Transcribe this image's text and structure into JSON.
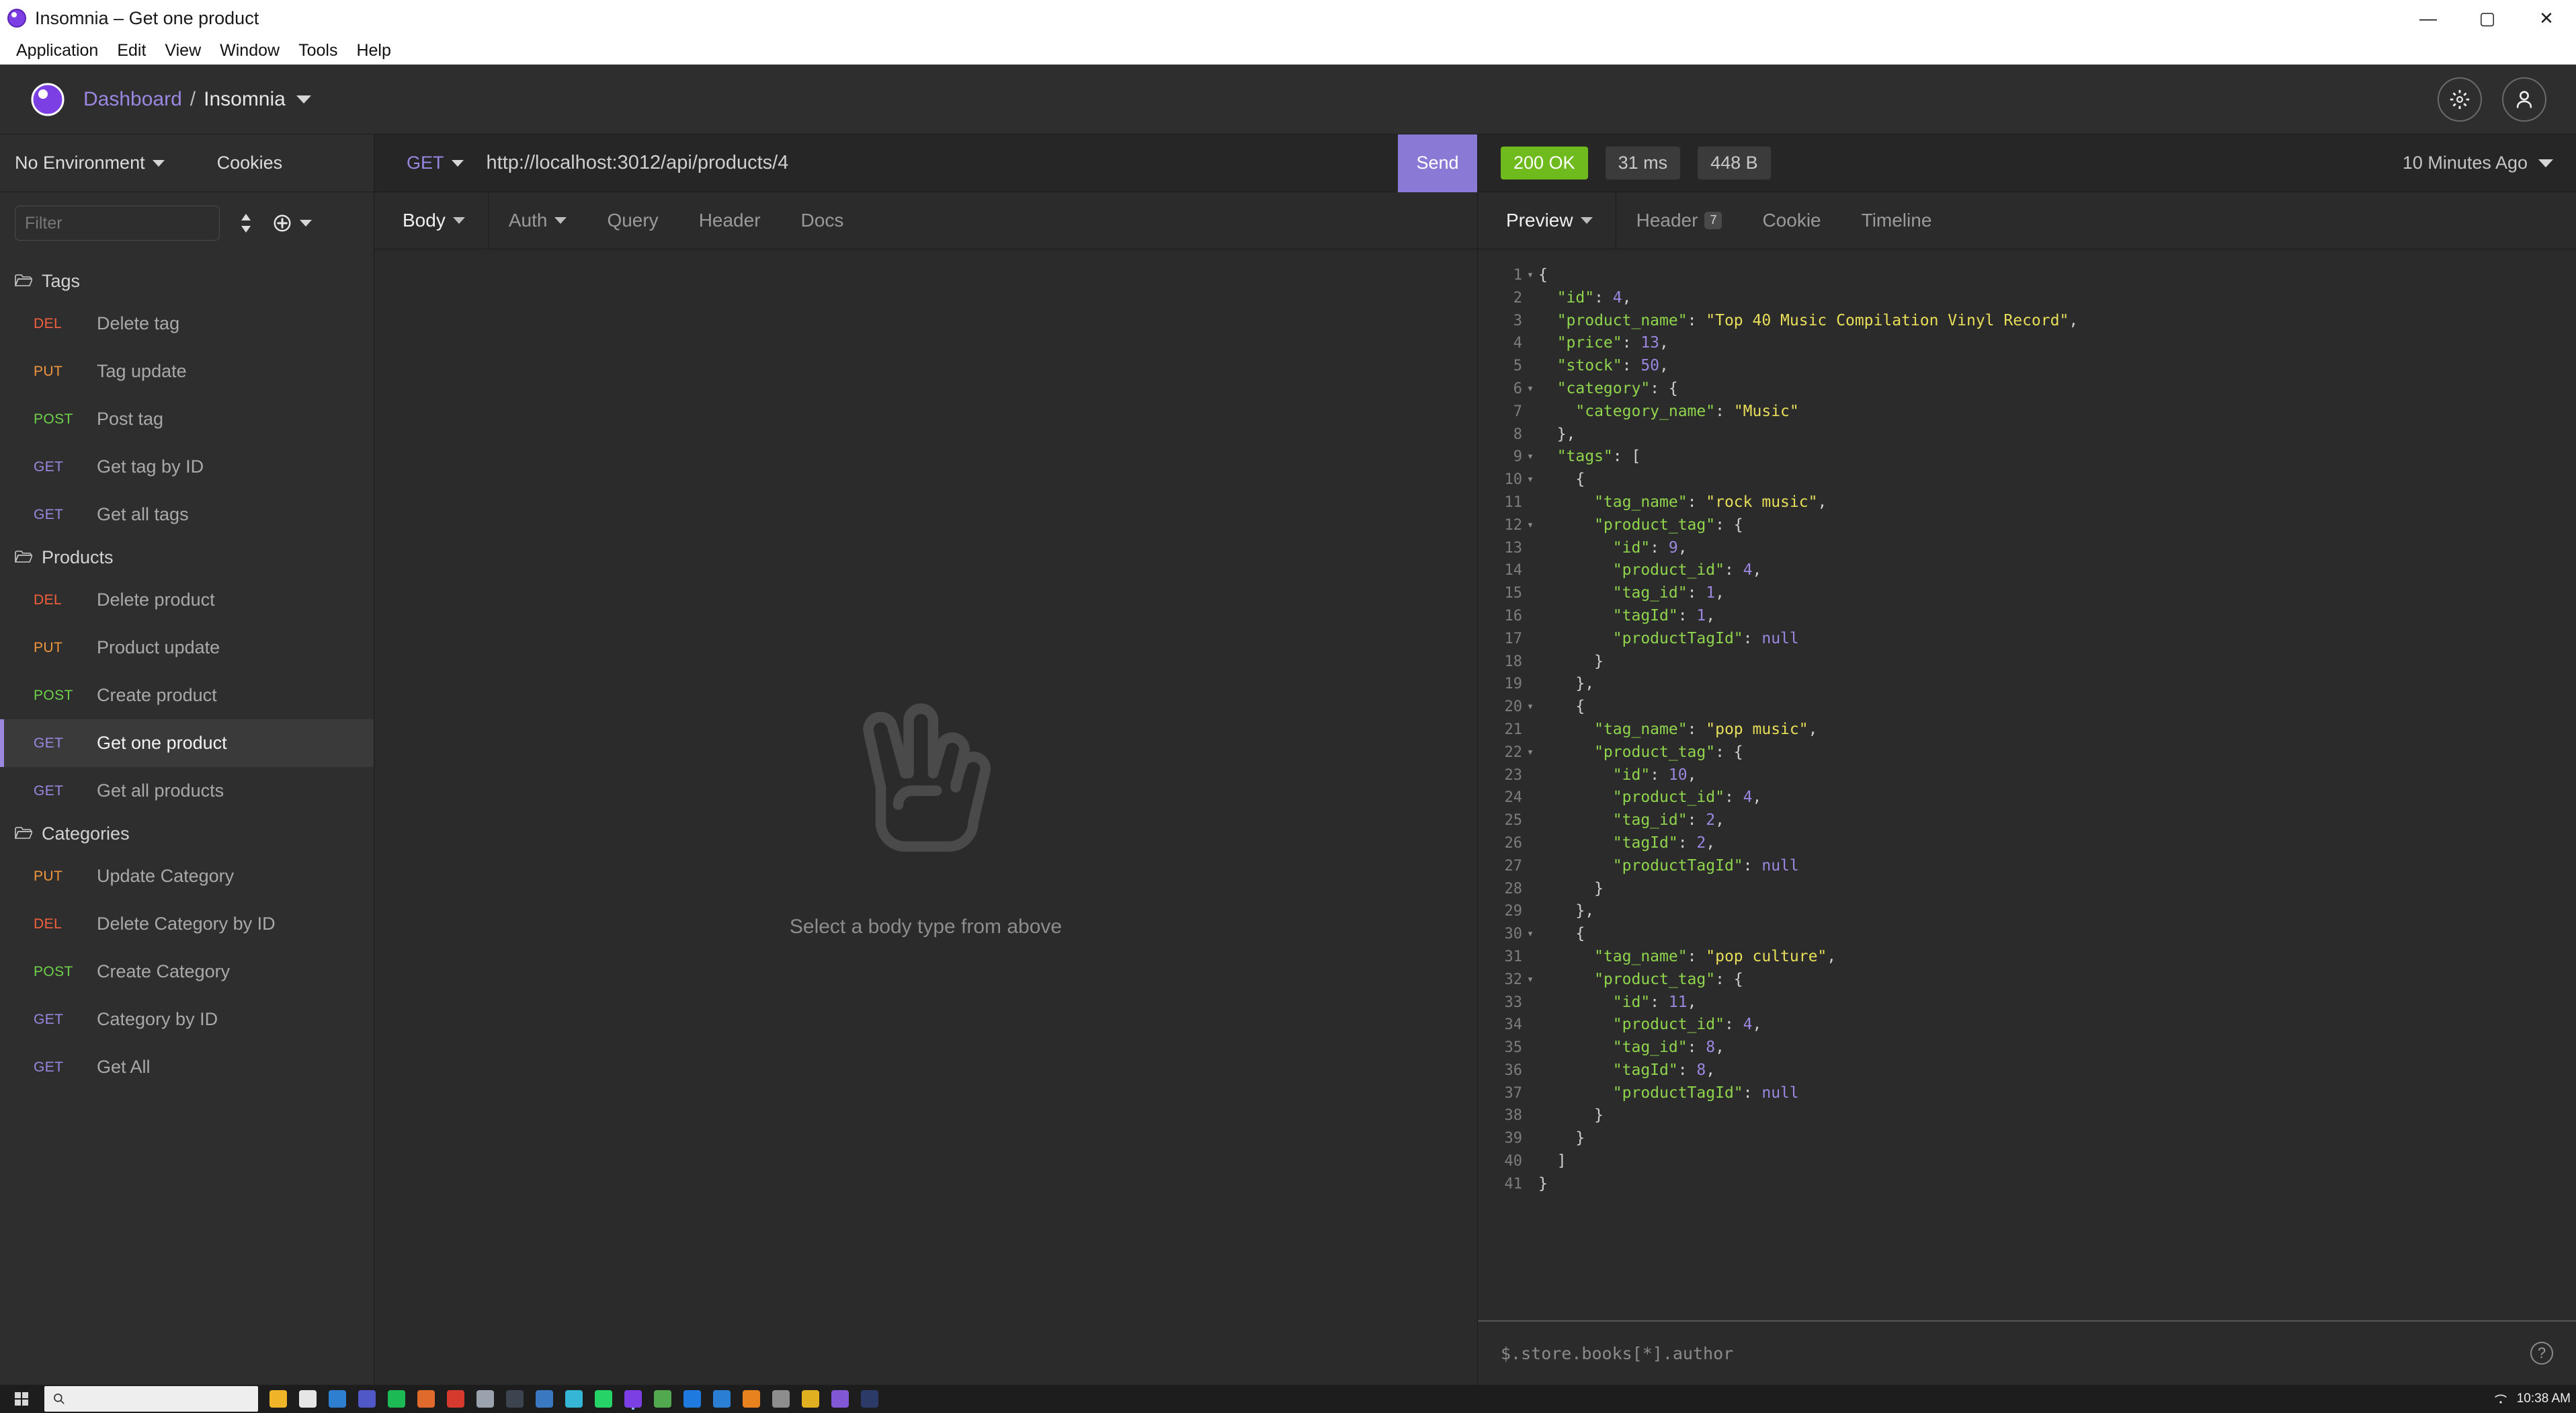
{
  "window": {
    "title": "Insomnia – Get one product",
    "minimize": "—",
    "maximize": "▢",
    "close": "✕"
  },
  "menubar": [
    "Application",
    "Edit",
    "View",
    "Window",
    "Tools",
    "Help"
  ],
  "header": {
    "breadcrumb_root": "Dashboard",
    "breadcrumb_sep": "/",
    "breadcrumb_current": "Insomnia",
    "settings_icon": "gear-icon",
    "account_icon": "user-icon"
  },
  "sidebar": {
    "environment": "No Environment",
    "cookies": "Cookies",
    "filter_placeholder": "Filter",
    "sort_icon": "sort-icon",
    "add_icon": "plus-circle-icon",
    "groups": [
      {
        "name": "Tags",
        "requests": [
          {
            "method": "DEL",
            "method_class": "m-del",
            "name": "Delete tag",
            "active": false
          },
          {
            "method": "PUT",
            "method_class": "m-put",
            "name": "Tag update",
            "active": false
          },
          {
            "method": "POST",
            "method_class": "m-post",
            "name": "Post tag",
            "active": false
          },
          {
            "method": "GET",
            "method_class": "m-get",
            "name": "Get tag by ID",
            "active": false
          },
          {
            "method": "GET",
            "method_class": "m-get",
            "name": "Get all tags",
            "active": false
          }
        ]
      },
      {
        "name": "Products",
        "requests": [
          {
            "method": "DEL",
            "method_class": "m-del",
            "name": "Delete product",
            "active": false
          },
          {
            "method": "PUT",
            "method_class": "m-put",
            "name": "Product update",
            "active": false
          },
          {
            "method": "POST",
            "method_class": "m-post",
            "name": "Create product",
            "active": false
          },
          {
            "method": "GET",
            "method_class": "m-get",
            "name": "Get one product",
            "active": true
          },
          {
            "method": "GET",
            "method_class": "m-get",
            "name": "Get all products",
            "active": false
          }
        ]
      },
      {
        "name": "Categories",
        "requests": [
          {
            "method": "PUT",
            "method_class": "m-put",
            "name": "Update Category",
            "active": false
          },
          {
            "method": "DEL",
            "method_class": "m-del",
            "name": "Delete Category by ID",
            "active": false
          },
          {
            "method": "POST",
            "method_class": "m-post",
            "name": "Create Category",
            "active": false
          },
          {
            "method": "GET",
            "method_class": "m-get",
            "name": "Category by ID",
            "active": false
          },
          {
            "method": "GET",
            "method_class": "m-get",
            "name": "Get All",
            "active": false
          }
        ]
      }
    ]
  },
  "request": {
    "method": "GET",
    "url": "http://localhost:3012/api/products/4",
    "send_label": "Send",
    "tabs": [
      {
        "label": "Body",
        "active": true,
        "caret": true,
        "badge": null
      },
      {
        "label": "Auth",
        "active": false,
        "caret": true,
        "badge": null
      },
      {
        "label": "Query",
        "active": false,
        "caret": false,
        "badge": null
      },
      {
        "label": "Header",
        "active": false,
        "caret": false,
        "badge": null
      },
      {
        "label": "Docs",
        "active": false,
        "caret": false,
        "badge": null
      }
    ],
    "empty_state_text": "Select a body type from above",
    "empty_state_icon": "peace-hand-icon"
  },
  "response": {
    "status": "200 OK",
    "time": "31 ms",
    "size": "448 B",
    "timestamp": "10 Minutes Ago",
    "tabs": [
      {
        "label": "Preview",
        "active": true,
        "caret": true,
        "badge": null
      },
      {
        "label": "Header",
        "active": false,
        "caret": false,
        "badge": "7"
      },
      {
        "label": "Cookie",
        "active": false,
        "caret": false,
        "badge": null
      },
      {
        "label": "Timeline",
        "active": false,
        "caret": false,
        "badge": null
      }
    ],
    "jsonpath_placeholder": "$.store.books[*].author",
    "help_icon": "question-mark-icon",
    "code_lines": [
      {
        "n": 1,
        "fold": true,
        "tokens": [
          {
            "t": "{",
            "c": "p"
          }
        ]
      },
      {
        "n": 2,
        "fold": false,
        "tokens": [
          {
            "t": "  \"id\"",
            "c": "k"
          },
          {
            "t": ": ",
            "c": "p"
          },
          {
            "t": "4",
            "c": "n"
          },
          {
            "t": ",",
            "c": "p"
          }
        ]
      },
      {
        "n": 3,
        "fold": false,
        "tokens": [
          {
            "t": "  \"product_name\"",
            "c": "k"
          },
          {
            "t": ": ",
            "c": "p"
          },
          {
            "t": "\"Top 40 Music Compilation Vinyl Record\"",
            "c": "s"
          },
          {
            "t": ",",
            "c": "p"
          }
        ]
      },
      {
        "n": 4,
        "fold": false,
        "tokens": [
          {
            "t": "  \"price\"",
            "c": "k"
          },
          {
            "t": ": ",
            "c": "p"
          },
          {
            "t": "13",
            "c": "n"
          },
          {
            "t": ",",
            "c": "p"
          }
        ]
      },
      {
        "n": 5,
        "fold": false,
        "tokens": [
          {
            "t": "  \"stock\"",
            "c": "k"
          },
          {
            "t": ": ",
            "c": "p"
          },
          {
            "t": "50",
            "c": "n"
          },
          {
            "t": ",",
            "c": "p"
          }
        ]
      },
      {
        "n": 6,
        "fold": true,
        "tokens": [
          {
            "t": "  \"category\"",
            "c": "k"
          },
          {
            "t": ": {",
            "c": "p"
          }
        ]
      },
      {
        "n": 7,
        "fold": false,
        "tokens": [
          {
            "t": "    \"category_name\"",
            "c": "k"
          },
          {
            "t": ": ",
            "c": "p"
          },
          {
            "t": "\"Music\"",
            "c": "s"
          }
        ]
      },
      {
        "n": 8,
        "fold": false,
        "tokens": [
          {
            "t": "  },",
            "c": "p"
          }
        ]
      },
      {
        "n": 9,
        "fold": true,
        "tokens": [
          {
            "t": "  \"tags\"",
            "c": "k"
          },
          {
            "t": ": [",
            "c": "p"
          }
        ]
      },
      {
        "n": 10,
        "fold": true,
        "tokens": [
          {
            "t": "    {",
            "c": "p"
          }
        ]
      },
      {
        "n": 11,
        "fold": false,
        "tokens": [
          {
            "t": "      \"tag_name\"",
            "c": "k"
          },
          {
            "t": ": ",
            "c": "p"
          },
          {
            "t": "\"rock music\"",
            "c": "s"
          },
          {
            "t": ",",
            "c": "p"
          }
        ]
      },
      {
        "n": 12,
        "fold": true,
        "tokens": [
          {
            "t": "      \"product_tag\"",
            "c": "k"
          },
          {
            "t": ": {",
            "c": "p"
          }
        ]
      },
      {
        "n": 13,
        "fold": false,
        "tokens": [
          {
            "t": "        \"id\"",
            "c": "k"
          },
          {
            "t": ": ",
            "c": "p"
          },
          {
            "t": "9",
            "c": "n"
          },
          {
            "t": ",",
            "c": "p"
          }
        ]
      },
      {
        "n": 14,
        "fold": false,
        "tokens": [
          {
            "t": "        \"product_id\"",
            "c": "k"
          },
          {
            "t": ": ",
            "c": "p"
          },
          {
            "t": "4",
            "c": "n"
          },
          {
            "t": ",",
            "c": "p"
          }
        ]
      },
      {
        "n": 15,
        "fold": false,
        "tokens": [
          {
            "t": "        \"tag_id\"",
            "c": "k"
          },
          {
            "t": ": ",
            "c": "p"
          },
          {
            "t": "1",
            "c": "n"
          },
          {
            "t": ",",
            "c": "p"
          }
        ]
      },
      {
        "n": 16,
        "fold": false,
        "tokens": [
          {
            "t": "        \"tagId\"",
            "c": "k"
          },
          {
            "t": ": ",
            "c": "p"
          },
          {
            "t": "1",
            "c": "n"
          },
          {
            "t": ",",
            "c": "p"
          }
        ]
      },
      {
        "n": 17,
        "fold": false,
        "tokens": [
          {
            "t": "        \"productTagId\"",
            "c": "k"
          },
          {
            "t": ": ",
            "c": "p"
          },
          {
            "t": "null",
            "c": "n"
          }
        ]
      },
      {
        "n": 18,
        "fold": false,
        "tokens": [
          {
            "t": "      }",
            "c": "p"
          }
        ]
      },
      {
        "n": 19,
        "fold": false,
        "tokens": [
          {
            "t": "    },",
            "c": "p"
          }
        ]
      },
      {
        "n": 20,
        "fold": true,
        "tokens": [
          {
            "t": "    {",
            "c": "p"
          }
        ]
      },
      {
        "n": 21,
        "fold": false,
        "tokens": [
          {
            "t": "      \"tag_name\"",
            "c": "k"
          },
          {
            "t": ": ",
            "c": "p"
          },
          {
            "t": "\"pop music\"",
            "c": "s"
          },
          {
            "t": ",",
            "c": "p"
          }
        ]
      },
      {
        "n": 22,
        "fold": true,
        "tokens": [
          {
            "t": "      \"product_tag\"",
            "c": "k"
          },
          {
            "t": ": {",
            "c": "p"
          }
        ]
      },
      {
        "n": 23,
        "fold": false,
        "tokens": [
          {
            "t": "        \"id\"",
            "c": "k"
          },
          {
            "t": ": ",
            "c": "p"
          },
          {
            "t": "10",
            "c": "n"
          },
          {
            "t": ",",
            "c": "p"
          }
        ]
      },
      {
        "n": 24,
        "fold": false,
        "tokens": [
          {
            "t": "        \"product_id\"",
            "c": "k"
          },
          {
            "t": ": ",
            "c": "p"
          },
          {
            "t": "4",
            "c": "n"
          },
          {
            "t": ",",
            "c": "p"
          }
        ]
      },
      {
        "n": 25,
        "fold": false,
        "tokens": [
          {
            "t": "        \"tag_id\"",
            "c": "k"
          },
          {
            "t": ": ",
            "c": "p"
          },
          {
            "t": "2",
            "c": "n"
          },
          {
            "t": ",",
            "c": "p"
          }
        ]
      },
      {
        "n": 26,
        "fold": false,
        "tokens": [
          {
            "t": "        \"tagId\"",
            "c": "k"
          },
          {
            "t": ": ",
            "c": "p"
          },
          {
            "t": "2",
            "c": "n"
          },
          {
            "t": ",",
            "c": "p"
          }
        ]
      },
      {
        "n": 27,
        "fold": false,
        "tokens": [
          {
            "t": "        \"productTagId\"",
            "c": "k"
          },
          {
            "t": ": ",
            "c": "p"
          },
          {
            "t": "null",
            "c": "n"
          }
        ]
      },
      {
        "n": 28,
        "fold": false,
        "tokens": [
          {
            "t": "      }",
            "c": "p"
          }
        ]
      },
      {
        "n": 29,
        "fold": false,
        "tokens": [
          {
            "t": "    },",
            "c": "p"
          }
        ]
      },
      {
        "n": 30,
        "fold": true,
        "tokens": [
          {
            "t": "    {",
            "c": "p"
          }
        ]
      },
      {
        "n": 31,
        "fold": false,
        "tokens": [
          {
            "t": "      \"tag_name\"",
            "c": "k"
          },
          {
            "t": ": ",
            "c": "p"
          },
          {
            "t": "\"pop culture\"",
            "c": "s"
          },
          {
            "t": ",",
            "c": "p"
          }
        ]
      },
      {
        "n": 32,
        "fold": true,
        "tokens": [
          {
            "t": "      \"product_tag\"",
            "c": "k"
          },
          {
            "t": ": {",
            "c": "p"
          }
        ]
      },
      {
        "n": 33,
        "fold": false,
        "tokens": [
          {
            "t": "        \"id\"",
            "c": "k"
          },
          {
            "t": ": ",
            "c": "p"
          },
          {
            "t": "11",
            "c": "n"
          },
          {
            "t": ",",
            "c": "p"
          }
        ]
      },
      {
        "n": 34,
        "fold": false,
        "tokens": [
          {
            "t": "        \"product_id\"",
            "c": "k"
          },
          {
            "t": ": ",
            "c": "p"
          },
          {
            "t": "4",
            "c": "n"
          },
          {
            "t": ",",
            "c": "p"
          }
        ]
      },
      {
        "n": 35,
        "fold": false,
        "tokens": [
          {
            "t": "        \"tag_id\"",
            "c": "k"
          },
          {
            "t": ": ",
            "c": "p"
          },
          {
            "t": "8",
            "c": "n"
          },
          {
            "t": ",",
            "c": "p"
          }
        ]
      },
      {
        "n": 36,
        "fold": false,
        "tokens": [
          {
            "t": "        \"tagId\"",
            "c": "k"
          },
          {
            "t": ": ",
            "c": "p"
          },
          {
            "t": "8",
            "c": "n"
          },
          {
            "t": ",",
            "c": "p"
          }
        ]
      },
      {
        "n": 37,
        "fold": false,
        "tokens": [
          {
            "t": "        \"productTagId\"",
            "c": "k"
          },
          {
            "t": ": ",
            "c": "p"
          },
          {
            "t": "null",
            "c": "n"
          }
        ]
      },
      {
        "n": 38,
        "fold": false,
        "tokens": [
          {
            "t": "      }",
            "c": "p"
          }
        ]
      },
      {
        "n": 39,
        "fold": false,
        "tokens": [
          {
            "t": "    }",
            "c": "p"
          }
        ]
      },
      {
        "n": 40,
        "fold": false,
        "tokens": [
          {
            "t": "  ]",
            "c": "p"
          }
        ]
      },
      {
        "n": 41,
        "fold": false,
        "tokens": [
          {
            "t": "}",
            "c": "p"
          }
        ]
      }
    ]
  },
  "taskbar": {
    "search_placeholder": "",
    "clock_time": "10:38 AM",
    "items": [
      {
        "name": "taskbar-file-explorer",
        "color": "#f0b429"
      },
      {
        "name": "taskbar-app-white",
        "color": "#e6e6e6"
      },
      {
        "name": "taskbar-edge",
        "color": "#2f7fd1"
      },
      {
        "name": "taskbar-teams",
        "color": "#4f58c6"
      },
      {
        "name": "taskbar-spotify",
        "color": "#1db954"
      },
      {
        "name": "taskbar-app-orange",
        "color": "#e06a2b"
      },
      {
        "name": "taskbar-app-red",
        "color": "#d63a2f"
      },
      {
        "name": "taskbar-app-grey",
        "color": "#9aa3ad"
      },
      {
        "name": "taskbar-app-dark",
        "color": "#3c4450"
      },
      {
        "name": "taskbar-app-blue2",
        "color": "#3a78c2"
      },
      {
        "name": "taskbar-app-cyan",
        "color": "#35b6d6"
      },
      {
        "name": "taskbar-whatsapp",
        "color": "#25d366"
      },
      {
        "name": "taskbar-insomnia",
        "color": "#7b3fe4"
      },
      {
        "name": "taskbar-app-green2",
        "color": "#51a84f"
      },
      {
        "name": "taskbar-app-blue3",
        "color": "#1f7ae0"
      },
      {
        "name": "taskbar-vscode",
        "color": "#2a7fd4"
      },
      {
        "name": "taskbar-app-orange2",
        "color": "#e8821e"
      },
      {
        "name": "taskbar-app-grey2",
        "color": "#8d8d8d"
      },
      {
        "name": "taskbar-app-yellow",
        "color": "#e0b020"
      },
      {
        "name": "taskbar-app-purple",
        "color": "#8257d6"
      },
      {
        "name": "taskbar-app-navy",
        "color": "#2b3a67"
      }
    ]
  },
  "colors": {
    "accent": "#7b3fe4",
    "send_button": "#8a7ad6",
    "status_ok": "#6fba1c",
    "method_get": "#9b87e0",
    "method_post": "#6fd14a",
    "method_put": "#f0963d",
    "method_del": "#f4603e",
    "json_key": "#8fd44c",
    "json_string": "#e8de5a",
    "json_number": "#9b87e0"
  }
}
